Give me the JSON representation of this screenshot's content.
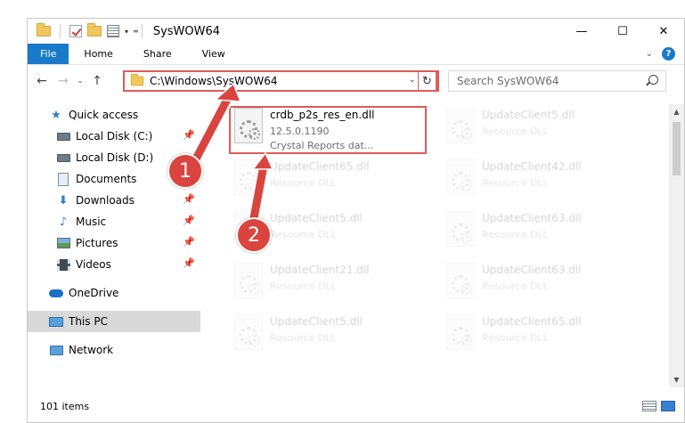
{
  "window": {
    "title": "SysWOW64",
    "controls": {
      "minimize": "—",
      "maximize": "☐",
      "close": "✕"
    }
  },
  "ribbon": {
    "tabs": [
      {
        "label": "File"
      },
      {
        "label": "Home"
      },
      {
        "label": "Share"
      },
      {
        "label": "View"
      }
    ],
    "help": "?"
  },
  "navigation": {
    "back": "←",
    "forward": "→",
    "recent": "⌄",
    "up": "↑",
    "address": "C:\\Windows\\SysWOW64",
    "refresh": "↻",
    "search_placeholder": "Search SysWOW64"
  },
  "sidebar": {
    "items": [
      {
        "label": "Quick access",
        "icon": "star-icon"
      },
      {
        "label": "Local Disk (C:)",
        "icon": "drive-icon",
        "pinned": true
      },
      {
        "label": "Local Disk (D:)",
        "icon": "drive-icon",
        "pinned": false
      },
      {
        "label": "Documents",
        "icon": "document-icon",
        "pinned": true
      },
      {
        "label": "Downloads",
        "icon": "download-icon",
        "pinned": true
      },
      {
        "label": "Music",
        "icon": "music-icon",
        "pinned": true
      },
      {
        "label": "Pictures",
        "icon": "pictures-icon",
        "pinned": true
      },
      {
        "label": "Videos",
        "icon": "videos-icon",
        "pinned": true
      },
      {
        "label": "OneDrive",
        "icon": "cloud-icon"
      },
      {
        "label": "This PC",
        "icon": "computer-icon",
        "selected": true
      },
      {
        "label": "Network",
        "icon": "network-icon"
      }
    ]
  },
  "files": {
    "highlighted": {
      "name": "crdb_p2s_res_en.dll",
      "version": "12.5.0.1190",
      "description": "Crystal Reports dat..."
    },
    "faded": [
      {
        "name": "UpdateClient5.dll",
        "type": "Resource DLL"
      },
      {
        "name": "UpdateClient65.dll",
        "type": "Resource DLL"
      },
      {
        "name": "UpdateClient42.dll",
        "type": "Resource DLL"
      },
      {
        "name": "UpdateClient5.dll",
        "type": "Resource DLL"
      },
      {
        "name": "UpdateClient63.dll",
        "type": "Resource DLL"
      },
      {
        "name": "UpdateClient21.dll",
        "type": "Resource DLL"
      },
      {
        "name": "UpdateClient63.dll",
        "type": "Resource DLL"
      },
      {
        "name": "UpdateClient5.dll",
        "type": "Resource DLL"
      },
      {
        "name": "UpdateClient65.dll",
        "type": "Resource DLL"
      }
    ]
  },
  "status": {
    "item_count": "101 items"
  },
  "callouts": {
    "first": "1",
    "second": "2"
  },
  "colors": {
    "accent": "#1979ca",
    "annotation_red": "#d9453e",
    "selection": "#d9d9d9"
  }
}
